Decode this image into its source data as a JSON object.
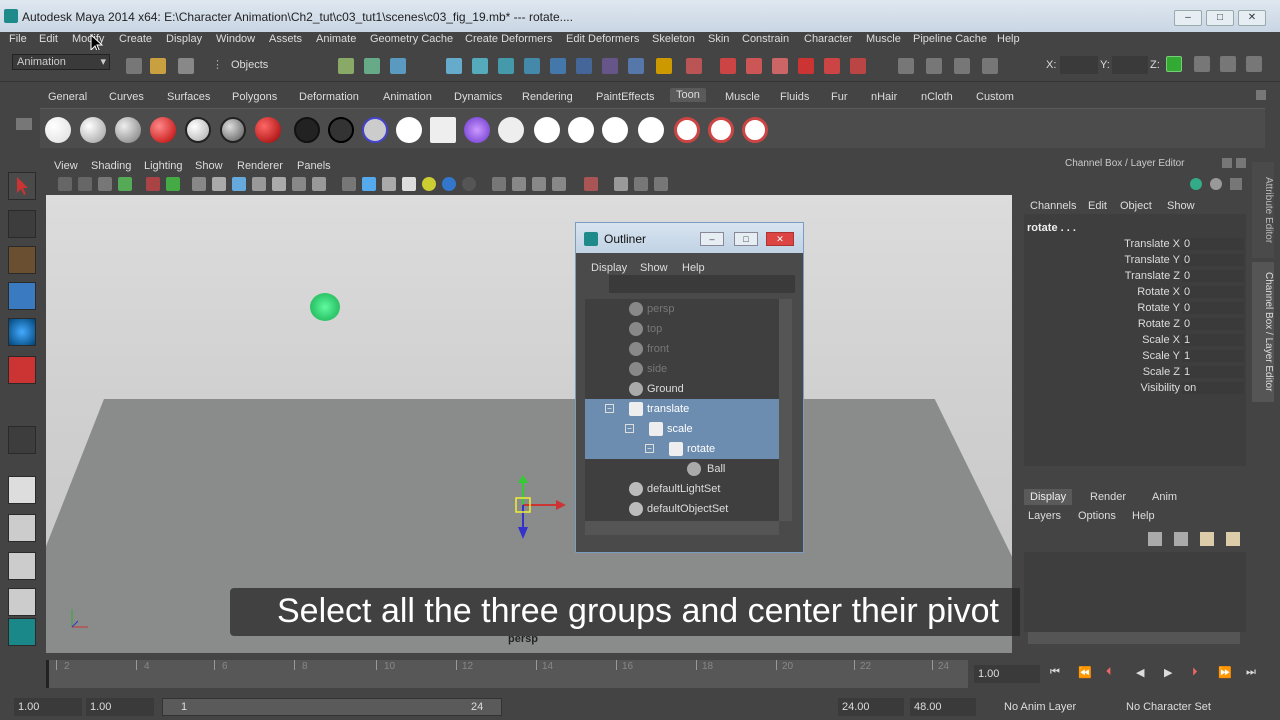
{
  "window": {
    "title": "Autodesk Maya 2014 x64: E:\\Character Animation\\Ch2_tut\\c03_tut1\\scenes\\c03_fig_19.mb*   ---    rotate....",
    "min": "–",
    "max": "□",
    "close": "✕"
  },
  "menubar": [
    "File",
    "Edit",
    "Modify",
    "Create",
    "Display",
    "Window",
    "Assets",
    "Animate",
    "Geometry Cache",
    "Create Deformers",
    "Edit Deformers",
    "Skeleton",
    "Skin",
    "Constrain",
    "Character",
    "Muscle",
    "Pipeline Cache",
    "Help"
  ],
  "statusline": {
    "mode": "Animation",
    "objects": "Objects",
    "x_label": "X:",
    "y_label": "Y:",
    "z_label": "Z:"
  },
  "shelf_tabs": [
    "General",
    "Curves",
    "Surfaces",
    "Polygons",
    "Deformation",
    "Animation",
    "Dynamics",
    "Rendering",
    "PaintEffects",
    "Toon",
    "Muscle",
    "Fluids",
    "Fur",
    "nHair",
    "nCloth",
    "Custom"
  ],
  "shelf_active": "Toon",
  "panel_menu": [
    "View",
    "Shading",
    "Lighting",
    "Show",
    "Renderer",
    "Panels"
  ],
  "viewport": {
    "camera": "persp"
  },
  "caption": "Select all the three groups and center their pivot",
  "outliner": {
    "title": "Outliner",
    "menu": [
      "Display",
      "Show",
      "Help"
    ],
    "items": [
      {
        "label": "persp",
        "dim": true,
        "indent": 0
      },
      {
        "label": "top",
        "dim": true,
        "indent": 0
      },
      {
        "label": "front",
        "dim": true,
        "indent": 0
      },
      {
        "label": "side",
        "dim": true,
        "indent": 0
      },
      {
        "label": "Ground",
        "dim": false,
        "indent": 0
      },
      {
        "label": "translate",
        "selected": true,
        "indent": 1
      },
      {
        "label": "scale",
        "selected": true,
        "indent": 2
      },
      {
        "label": "rotate",
        "selected": true,
        "indent": 3
      },
      {
        "label": "Ball",
        "indent": 4
      },
      {
        "label": "defaultLightSet",
        "indent": 0
      },
      {
        "label": "defaultObjectSet",
        "indent": 0
      }
    ]
  },
  "channel_box": {
    "title": "Channel Box / Layer Editor",
    "menu": [
      "Channels",
      "Edit",
      "Object",
      "Show"
    ],
    "object": "rotate . . .",
    "channels": [
      {
        "name": "Translate X",
        "value": "0"
      },
      {
        "name": "Translate Y",
        "value": "0"
      },
      {
        "name": "Translate Z",
        "value": "0"
      },
      {
        "name": "Rotate X",
        "value": "0"
      },
      {
        "name": "Rotate Y",
        "value": "0"
      },
      {
        "name": "Rotate Z",
        "value": "0"
      },
      {
        "name": "Scale X",
        "value": "1"
      },
      {
        "name": "Scale Y",
        "value": "1"
      },
      {
        "name": "Scale Z",
        "value": "1"
      },
      {
        "name": "Visibility",
        "value": "on"
      }
    ],
    "side_tabs": [
      "Attribute Editor",
      "Channel Box / Layer Editor"
    ]
  },
  "layer_editor": {
    "tabs": [
      "Display",
      "Render",
      "Anim"
    ],
    "menu": [
      "Layers",
      "Options",
      "Help"
    ]
  },
  "timeline": {
    "ticks": [
      "2",
      "4",
      "6",
      "8",
      "10",
      "12",
      "14",
      "16",
      "18",
      "20",
      "22",
      "24"
    ],
    "current": "1.00"
  },
  "range": {
    "start": "1.00",
    "cur_start": "1.00",
    "slider_start": "1",
    "slider_end": "24",
    "end": "24.00",
    "max": "48.00",
    "anim_layer": "No Anim Layer",
    "char_set": "No Character Set"
  }
}
